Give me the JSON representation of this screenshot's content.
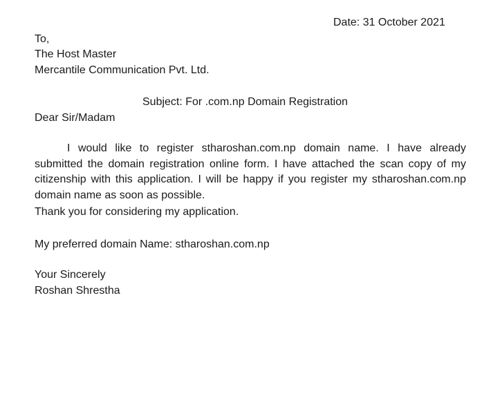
{
  "letter": {
    "date": "Date: 31 October 2021",
    "to": "To,",
    "recipient_name": "The Host Master",
    "recipient_org": "Mercantile Communication Pvt. Ltd.",
    "subject": "Subject: For .com.np Domain Registration",
    "salutation": "Dear Sir/Madam",
    "body": "I would like to register stharoshan.com.np domain name. I have already submitted the domain registration online form. I have attached the scan copy of my citizenship with this application. I will be happy if you register my stharoshan.com.np domain name as soon as possible.",
    "thanks": "Thank you for considering my application.",
    "preferred_domain": "My preferred domain Name: stharoshan.com.np",
    "closing": "Your Sincerely",
    "signature": "Roshan Shrestha"
  }
}
